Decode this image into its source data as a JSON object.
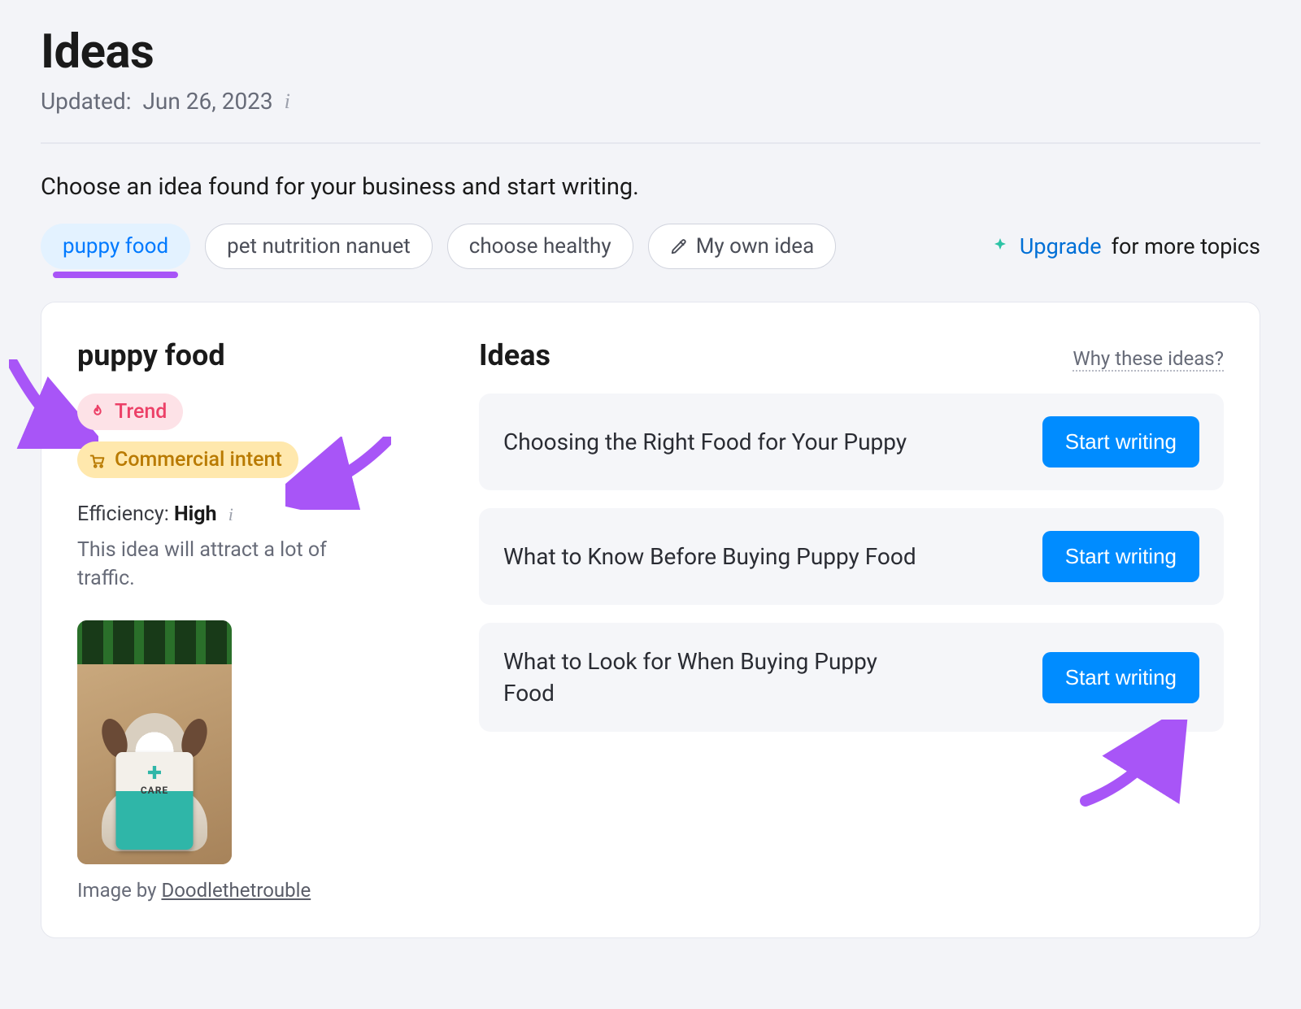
{
  "header": {
    "title": "Ideas",
    "updated_prefix": "Updated:",
    "updated_date": "Jun 26, 2023"
  },
  "prompt": "Choose an idea found for your business and start writing.",
  "chips": [
    {
      "label": "puppy food",
      "active": true
    },
    {
      "label": "pet nutrition nanuet",
      "active": false
    },
    {
      "label": "choose healthy",
      "active": false
    },
    {
      "label": "My own idea",
      "active": false,
      "icon": "pencil"
    }
  ],
  "upgrade": {
    "link": "Upgrade",
    "suffix": "for more topics"
  },
  "topic": {
    "title": "puppy food",
    "badges": {
      "trend": "Trend",
      "intent": "Commercial intent"
    },
    "efficiency_label": "Efficiency:",
    "efficiency_value": "High",
    "efficiency_desc": "This idea will attract a lot of traffic.",
    "image_credit_prefix": "Image by",
    "image_credit_name": "Doodlethetrouble",
    "image_bag_label": "CARE"
  },
  "ideas": {
    "heading": "Ideas",
    "why_link": "Why these ideas?",
    "start_label": "Start writing",
    "items": [
      "Choosing the Right Food for Your Puppy",
      "What to Know Before Buying Puppy Food",
      "What to Look for When Buying Puppy Food"
    ]
  },
  "colors": {
    "accent_blue": "#008cff",
    "annotation_purple": "#a855f7"
  }
}
